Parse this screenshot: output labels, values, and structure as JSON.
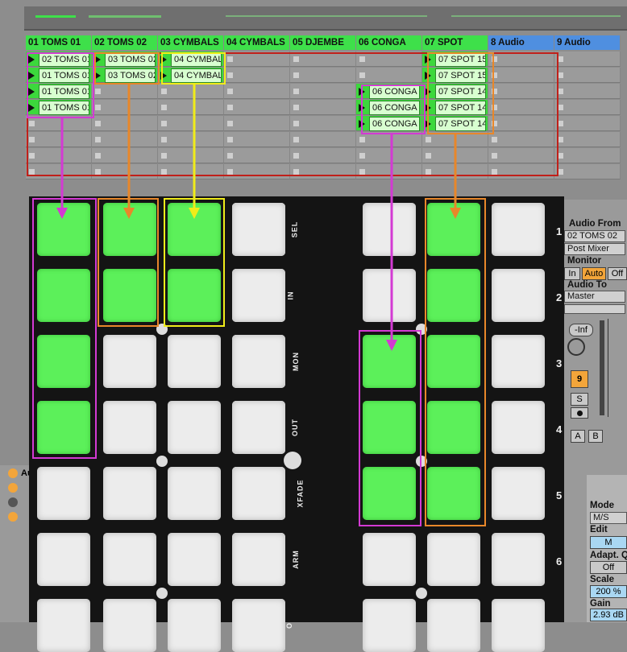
{
  "track_headers": [
    {
      "label": "01 TOMS 01",
      "color": "#3ee04a"
    },
    {
      "label": "02 TOMS 02",
      "color": "#3ee04a"
    },
    {
      "label": "03 CYMBALS",
      "color": "#3ee04a"
    },
    {
      "label": "04 CYMBALS",
      "color": "#3ee04a"
    },
    {
      "label": "05 DJEMBE",
      "color": "#3ee04a"
    },
    {
      "label": "06 CONGA",
      "color": "#3ee04a"
    },
    {
      "label": "07 SPOT",
      "color": "#3ee04a"
    },
    {
      "label": "8 Audio",
      "color": "#4f8fe0"
    },
    {
      "label": "9 Audio",
      "color": "#4f8fe0"
    }
  ],
  "clips": [
    [
      "02 TOMS 01",
      "03 TOMS 02",
      "04 CYMBAL",
      "",
      "",
      "",
      "07 SPOT 15",
      "",
      ""
    ],
    [
      "01 TOMS 01",
      "03 TOMS 02",
      "04 CYMBAL",
      "",
      "",
      "",
      "07 SPOT 15",
      "",
      ""
    ],
    [
      "01 TOMS 01",
      "",
      "",
      "",
      "",
      "06 CONGA",
      "07 SPOT 14",
      "",
      ""
    ],
    [
      "01 TOMS 01",
      "",
      "",
      "",
      "",
      "06 CONGA",
      "07 SPOT 14",
      "",
      ""
    ],
    [
      "",
      "",
      "",
      "",
      "",
      "06 CONGA",
      "07 SPOT 14",
      "",
      ""
    ],
    [
      "",
      "",
      "",
      "",
      "",
      "",
      "",
      "",
      ""
    ],
    [
      "",
      "",
      "",
      "",
      "",
      "",
      "",
      "",
      ""
    ],
    [
      "",
      "",
      "",
      "",
      "",
      "",
      "",
      "",
      ""
    ]
  ],
  "mixer": {
    "audio_from_label": "Audio From",
    "audio_from_value": "02 TOMS 02",
    "post_mixer": "Post Mixer",
    "monitor_label": "Monitor",
    "monitor_in": "In",
    "monitor_auto": "Auto",
    "monitor_off": "Off",
    "audio_to_label": "Audio To",
    "audio_to_value": "Master",
    "volume": "-Inf",
    "track_number": "9",
    "solo": "S",
    "send_a": "A",
    "send_b": "B"
  },
  "clip_view": {
    "mode_label": "Mode",
    "mode_value": "M/S",
    "edit_label": "Edit",
    "edit_value": "M",
    "adapt_label": "Adapt. Q",
    "adapt_value": "Off",
    "scale_label": "Scale",
    "scale_value": "200 %",
    "gain_label": "Gain",
    "gain_value": "2.93 dB",
    "device_title": "Au"
  },
  "pad_grid": {
    "on_cells": [
      [
        0,
        0
      ],
      [
        1,
        0
      ],
      [
        2,
        0
      ],
      [
        3,
        0
      ],
      [
        0,
        1
      ],
      [
        1,
        1
      ],
      [
        0,
        2
      ],
      [
        1,
        2
      ],
      [
        2,
        5
      ],
      [
        3,
        5
      ],
      [
        4,
        5
      ],
      [
        0,
        6
      ],
      [
        1,
        6
      ],
      [
        2,
        6
      ],
      [
        3,
        6
      ],
      [
        4,
        6
      ]
    ],
    "function_labels": [
      "SEL",
      "IN",
      "MON",
      "OUT",
      "XFADE",
      "ARM",
      "O"
    ],
    "row_numbers": [
      "1",
      "2",
      "3",
      "4",
      "5",
      "6"
    ]
  },
  "colors": {
    "pad_on": "#5cf05a",
    "pad_off": "#ececec",
    "annotation_magenta": "#d33ad3",
    "annotation_orange": "#e8872a",
    "annotation_yellow": "#f0ec1a",
    "clip_box_red": "#c0201a"
  }
}
